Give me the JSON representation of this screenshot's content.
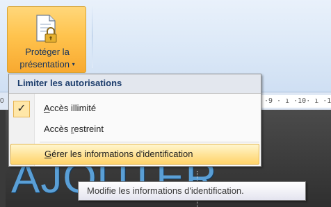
{
  "ribbon": {
    "protect_button": {
      "line1": "Protéger la",
      "line2": "présentation",
      "dropdown_glyph": "▾",
      "icon": "document-lock-icon"
    }
  },
  "ruler": {
    "left_text": "0",
    "right_text": "·9 · ı ·10· ı ·11·"
  },
  "slide": {
    "title_text": "AJOUTER"
  },
  "menu": {
    "header": "Limiter les autorisations",
    "items": [
      {
        "prefix": "",
        "accel": "A",
        "rest": "ccès illimité",
        "checked": true,
        "check_glyph": "✓"
      },
      {
        "prefix": "Accès ",
        "accel": "r",
        "rest": "estreint",
        "checked": false
      },
      {
        "prefix": "",
        "accel": "G",
        "rest": "érer les informations d'identification",
        "highlighted": true
      }
    ]
  },
  "tooltip": {
    "text": "Modifie les informations d'identification."
  },
  "colors": {
    "button_highlight": "#ffc34d",
    "menu_header_text": "#1a3b6b",
    "slide_title": "#5a9fd6"
  }
}
